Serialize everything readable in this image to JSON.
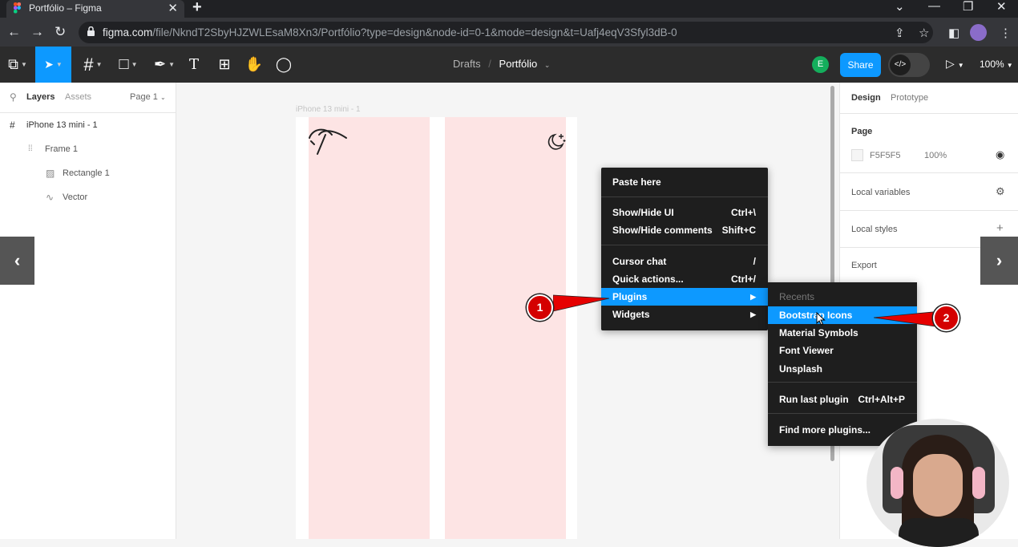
{
  "browser": {
    "tab_title": "Portfólio – Figma",
    "tab_close": "✕",
    "new_tab": "+",
    "window_controls": [
      "⌄",
      "—",
      "❐",
      "✕"
    ],
    "url_domain": "figma.com",
    "url_path": "/file/NkndT2SbyHJZWLEsaM8Xn3/Portfólio?type=design&node-id=0-1&mode=design&t=Uafj4eqV3Sfyl3dB-0",
    "nav": {
      "back": "←",
      "forward": "→",
      "reload": "↻"
    }
  },
  "toolbar": {
    "tools": [
      {
        "name": "main-menu",
        "glyph": "⧉"
      },
      {
        "name": "move",
        "glyph": "➤"
      },
      {
        "name": "frame",
        "glyph": "#"
      },
      {
        "name": "shape",
        "glyph": "□"
      },
      {
        "name": "pen",
        "glyph": "✒"
      },
      {
        "name": "text",
        "glyph": "T"
      },
      {
        "name": "resources",
        "glyph": "⊞"
      },
      {
        "name": "hand",
        "glyph": "✋"
      },
      {
        "name": "comment",
        "glyph": "◯"
      }
    ],
    "breadcrumb_parent": "Drafts",
    "breadcrumb_sep": "/",
    "file_name": "Portfólio",
    "avatar_initial": "E",
    "share_label": "Share",
    "dev_mode_glyph": "</>",
    "present_glyph": "▷",
    "zoom": "100%"
  },
  "left_panel": {
    "tabs": [
      "Layers",
      "Assets"
    ],
    "page_select": "Page 1",
    "layers": [
      {
        "label": "iPhone 13 mini - 1",
        "icon": "#",
        "icon_name": "frame-icon"
      },
      {
        "label": "Frame 1",
        "icon": "⁞⁞",
        "icon_name": "autolayout-icon"
      },
      {
        "label": "Rectangle 1",
        "icon": "▨",
        "icon_name": "rectangle-icon"
      },
      {
        "label": "Vector",
        "icon": "∿",
        "icon_name": "vector-icon"
      }
    ]
  },
  "canvas": {
    "frame_label": "iPhone 13 mini - 1",
    "rect_color": "#fde4e4"
  },
  "right_panel": {
    "tabs": [
      "Design",
      "Prototype"
    ],
    "page_heading": "Page",
    "page_color": "F5F5F5",
    "page_opacity": "100%",
    "local_variables": "Local variables",
    "local_styles": "Local styles",
    "export": "Export"
  },
  "context_menu": {
    "items": [
      {
        "label": "Paste here",
        "shortcut": ""
      },
      {
        "label": "Show/Hide UI",
        "shortcut": "Ctrl+\\"
      },
      {
        "label": "Show/Hide comments",
        "shortcut": "Shift+C"
      },
      {
        "label": "Cursor chat",
        "shortcut": "/"
      },
      {
        "label": "Quick actions...",
        "shortcut": "Ctrl+/"
      },
      {
        "label": "Plugins",
        "shortcut": "▶"
      },
      {
        "label": "Widgets",
        "shortcut": "▶"
      }
    ]
  },
  "plugins_submenu": {
    "items": [
      {
        "label": "Recents",
        "shortcut": ""
      },
      {
        "label": "Bootstrap Icons",
        "shortcut": ""
      },
      {
        "label": "Material Symbols",
        "shortcut": ""
      },
      {
        "label": "Font Viewer",
        "shortcut": ""
      },
      {
        "label": "Unsplash",
        "shortcut": ""
      },
      {
        "label": "Run last plugin",
        "shortcut": "Ctrl+Alt+P"
      },
      {
        "label": "Find more plugins...",
        "shortcut": ""
      }
    ]
  },
  "callouts": [
    "1",
    "2"
  ],
  "overlay": {
    "prev": "‹",
    "next": "›"
  },
  "colors": {
    "accent": "#0d99ff",
    "callout": "#d40000",
    "menu_bg": "#1e1e1e"
  }
}
